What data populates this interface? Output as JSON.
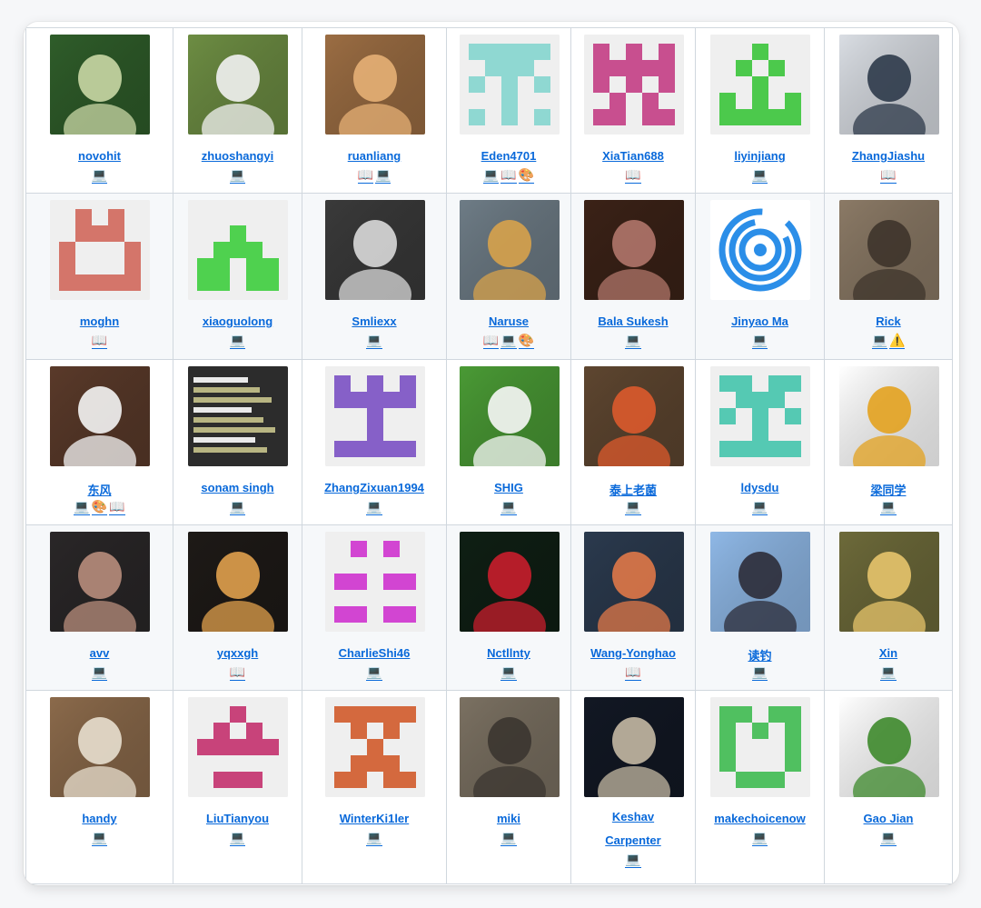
{
  "icons": {
    "code": "💻",
    "doc": "📖",
    "design": "🎨",
    "bug": "⚠️"
  },
  "rows": [
    [
      {
        "name": "novohit",
        "badges": [
          "code"
        ],
        "avatar": "photo",
        "bg": "#2f5d2a",
        "fg": "#c9d7a5"
      },
      {
        "name": "zhuoshangyi",
        "badges": [
          "code"
        ],
        "avatar": "photo",
        "bg": "#6d8d43",
        "fg": "#f2f2f2"
      },
      {
        "name": "ruanliang",
        "badges": [
          "doc",
          "code"
        ],
        "avatar": "photo",
        "bg": "#9b6d43",
        "fg": "#e6b076"
      },
      {
        "name": "Eden4701",
        "badges": [
          "code",
          "doc",
          "design"
        ],
        "avatar": "identicon",
        "color": "#8fd8d2",
        "pattern": [
          "11111",
          "01110",
          "10101",
          "00100",
          "10101"
        ]
      },
      {
        "name": "XiaTian688",
        "badges": [
          "doc"
        ],
        "avatar": "identicon",
        "color": "#c84f8f",
        "pattern": [
          "10101",
          "11111",
          "10101",
          "01010",
          "11011"
        ]
      },
      {
        "name": "liyinjiang",
        "badges": [
          "code"
        ],
        "avatar": "identicon",
        "color": "#4cc94c",
        "pattern": [
          "00100",
          "01010",
          "00100",
          "10101",
          "11111"
        ]
      },
      {
        "name": "ZhangJiashu",
        "badges": [
          "doc"
        ],
        "avatar": "photo",
        "bg": "#d9dde3",
        "fg": "#2d3a4a"
      }
    ],
    [
      {
        "name": "moghn",
        "badges": [
          "doc"
        ],
        "avatar": "identicon",
        "color": "#d4756a",
        "pattern": [
          "01010",
          "01110",
          "10001",
          "10001",
          "11111"
        ]
      },
      {
        "name": "xiaoguolong",
        "badges": [
          "code"
        ],
        "avatar": "identicon",
        "color": "#4fd14f",
        "pattern": [
          "00000",
          "00100",
          "01110",
          "11011",
          "11011"
        ]
      },
      {
        "name": "Smliexx",
        "badges": [
          "code"
        ],
        "avatar": "photo",
        "bg": "#3a3a3a",
        "fg": "#d9d9d9"
      },
      {
        "name": "Naruse",
        "badges": [
          "doc",
          "code",
          "design"
        ],
        "avatar": "photo",
        "bg": "#6e7c86",
        "fg": "#d7a24b"
      },
      {
        "name": "Bala Sukesh",
        "badges": [
          "code"
        ],
        "avatar": "photo",
        "bg": "#3b2217",
        "fg": "#b0766a"
      },
      {
        "name": "Jinyao Ma",
        "badges": [
          "code"
        ],
        "avatar": "target",
        "bg": "#ffffff",
        "fg": "#2b8ee8"
      },
      {
        "name": "Rick",
        "badges": [
          "code",
          "bug"
        ],
        "avatar": "photo",
        "bg": "#8b7a66",
        "fg": "#3e342b"
      }
    ],
    [
      {
        "name": "东风",
        "badges": [
          "code",
          "design",
          "doc"
        ],
        "avatar": "photo",
        "bg": "#5a3a2a",
        "fg": "#f4f4f4"
      },
      {
        "name": "sonam singh",
        "badges": [
          "code"
        ],
        "avatar": "text-poster",
        "bg": "#2c2c2c",
        "fg": "#c8c48c"
      },
      {
        "name": "ZhangZixuan1994",
        "badges": [
          "code"
        ],
        "avatar": "identicon",
        "color": "#8660c8",
        "pattern": [
          "10101",
          "11111",
          "00100",
          "00100",
          "11111"
        ]
      },
      {
        "name": "SHIG",
        "badges": [
          "code"
        ],
        "avatar": "photo",
        "bg": "#4a9a35",
        "fg": "#f7f7f7"
      },
      {
        "name": "泰上老菌",
        "badges": [
          "code"
        ],
        "avatar": "photo",
        "bg": "#5e4630",
        "fg": "#dc5a2c"
      },
      {
        "name": "ldysdu",
        "badges": [
          "code"
        ],
        "avatar": "identicon",
        "color": "#55c9b3",
        "pattern": [
          "11011",
          "01110",
          "10101",
          "00100",
          "11111"
        ]
      },
      {
        "name": "梁同学",
        "badges": [
          "code"
        ],
        "avatar": "photo",
        "bg": "#ffffff",
        "fg": "#e3a21f"
      }
    ],
    [
      {
        "name": "avv",
        "badges": [
          "code"
        ],
        "avatar": "photo",
        "bg": "#2a2728",
        "fg": "#b88d7c"
      },
      {
        "name": "yqxxgh",
        "badges": [
          "doc"
        ],
        "avatar": "photo",
        "bg": "#1e1a17",
        "fg": "#e0a04c"
      },
      {
        "name": "CharlieShi46",
        "badges": [
          "code"
        ],
        "avatar": "identicon",
        "color": "#d245d2",
        "pattern": [
          "01010",
          "00000",
          "11011",
          "00000",
          "11011"
        ]
      },
      {
        "name": "Nctllnty",
        "badges": [
          "code"
        ],
        "avatar": "photo",
        "bg": "#0f1f14",
        "fg": "#c81e2c"
      },
      {
        "name": "Wang-Yonghao",
        "badges": [
          "doc"
        ],
        "avatar": "photo",
        "bg": "#2b3a4e",
        "fg": "#e07848"
      },
      {
        "name": "读钓",
        "badges": [
          "code"
        ],
        "avatar": "photo",
        "bg": "#8fb8e6",
        "fg": "#2c2c38"
      },
      {
        "name": "Xin",
        "badges": [
          "code"
        ],
        "avatar": "photo",
        "bg": "#6d6a3a",
        "fg": "#e7c46b"
      }
    ],
    [
      {
        "name": "handy",
        "badges": [
          "code"
        ],
        "avatar": "photo",
        "bg": "#8b6a4b",
        "fg": "#e8dfcf"
      },
      {
        "name": "LiuTianyou",
        "badges": [
          "code"
        ],
        "avatar": "identicon",
        "color": "#c8437a",
        "pattern": [
          "00100",
          "01010",
          "11111",
          "00000",
          "01110"
        ]
      },
      {
        "name": "WinterKi1ler",
        "badges": [
          "code"
        ],
        "avatar": "identicon",
        "color": "#d4693e",
        "pattern": [
          "11111",
          "01010",
          "00100",
          "01110",
          "11011"
        ]
      },
      {
        "name": "miki",
        "badges": [
          "code"
        ],
        "avatar": "photo",
        "bg": "#7b7162",
        "fg": "#3b3530"
      },
      {
        "name": "Keshav Carpenter",
        "badges": [
          "code"
        ],
        "avatar": "photo",
        "bg": "#121824",
        "fg": "#c4b8a3"
      },
      {
        "name": "makechoicenow",
        "badges": [
          "code"
        ],
        "avatar": "identicon",
        "color": "#50c060",
        "pattern": [
          "11011",
          "10101",
          "10001",
          "10001",
          "01110"
        ]
      },
      {
        "name": "Gao Jian",
        "badges": [
          "code"
        ],
        "avatar": "photo",
        "bg": "#ffffff",
        "fg": "#3e8a2c"
      }
    ]
  ]
}
